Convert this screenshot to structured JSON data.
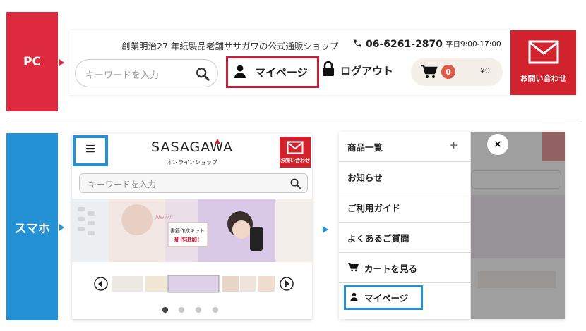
{
  "labels": {
    "pc": "PC",
    "smartphone": "スマホ"
  },
  "colors": {
    "pc_label_bg": "#dd2a3e",
    "sp_label_bg": "#2391d3",
    "accent_red": "#d2222d",
    "highlight_red": "#c8203b",
    "highlight_blue": "#2391d3",
    "cart_badge": "#e05a4a"
  },
  "pc_header": {
    "tagline": "創業明治27 年紙製品老舗ササガワの公式通販ショップ",
    "phone": "06-6261-2870",
    "phone_hours": "平日9:00-17:00",
    "search_placeholder": "キーワードを入力",
    "mypage_label": "マイページ",
    "logout_label": "ログアウト",
    "cart_count": "0",
    "cart_amount": "¥0",
    "contact_label": "お問い合わせ"
  },
  "mobile_home": {
    "menu_glyph": "≡",
    "brand": "SASAGAWA",
    "brand_sub": "オンラインショップ",
    "contact_label": "お問い合わせ",
    "search_placeholder": "キーワードを入力",
    "banner": {
      "badge": "New!",
      "kit_line1": "書籍作成キット",
      "kit_line2": "新作追加!"
    },
    "slide_count": 4,
    "active_slide": 1
  },
  "mobile_menu": {
    "items": [
      {
        "label": "商品一覧",
        "expand": "+"
      },
      {
        "label": "お知らせ"
      },
      {
        "label": "ご利用ガイド"
      },
      {
        "label": "よくあるご質問"
      },
      {
        "label": "カートを見る"
      },
      {
        "label": "マイページ"
      }
    ],
    "close_glyph": "×"
  }
}
